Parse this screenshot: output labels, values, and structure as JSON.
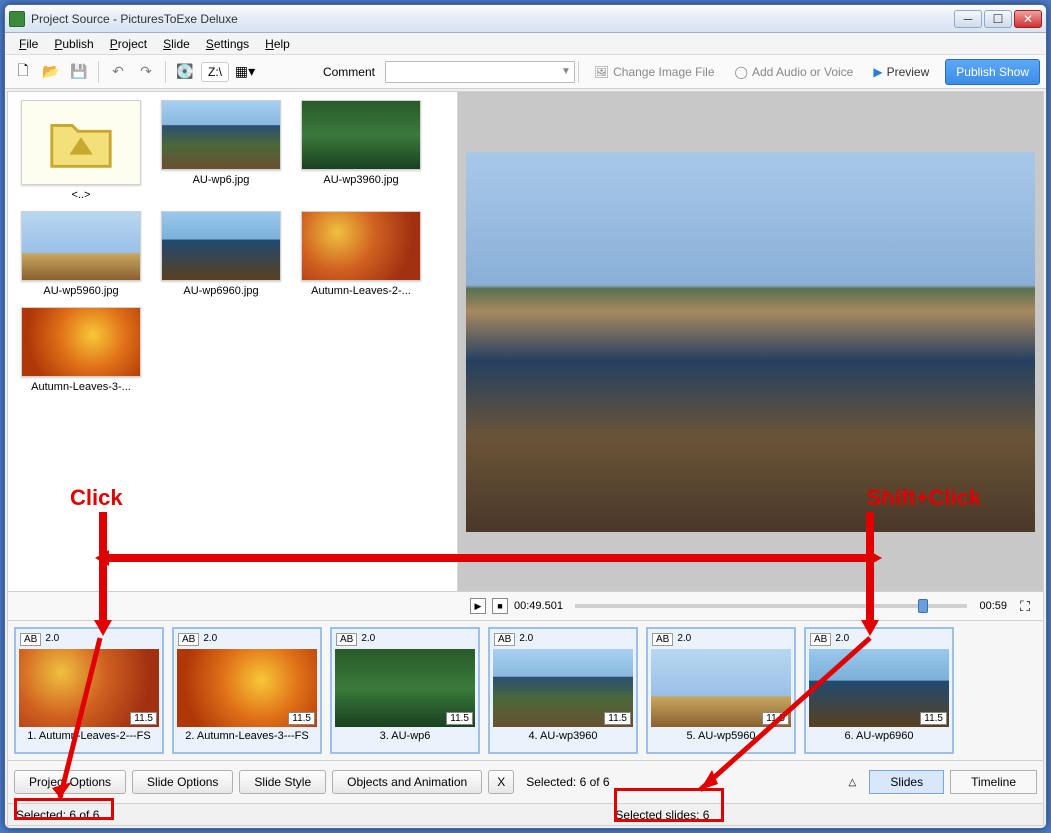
{
  "title": "Project Source - PicturesToExe Deluxe",
  "menu": [
    "File",
    "Publish",
    "Project",
    "Slide",
    "Settings",
    "Help"
  ],
  "toolbar": {
    "drive": "Z:\\",
    "comment_label": "Comment",
    "change_image": "Change Image File",
    "add_audio": "Add Audio or Voice",
    "preview": "Preview",
    "publish": "Publish Show"
  },
  "browser": {
    "items": [
      {
        "type": "folder",
        "caption": "<..>"
      },
      {
        "type": "img",
        "caption": "AU-wp6.jpg",
        "cls": "land-a"
      },
      {
        "type": "img",
        "caption": "AU-wp3960.jpg",
        "cls": "land-c"
      },
      {
        "type": "img",
        "caption": "AU-wp5960.jpg",
        "cls": "land-d"
      },
      {
        "type": "img",
        "caption": "AU-wp6960.jpg",
        "cls": "land-b"
      },
      {
        "type": "img",
        "caption": "Autumn-Leaves-2-...",
        "cls": "leaf-a"
      },
      {
        "type": "img",
        "caption": "Autumn-Leaves-3-...",
        "cls": "leaf-b"
      }
    ]
  },
  "playbar": {
    "time": "00:49.501",
    "end": "00:59"
  },
  "slides": [
    {
      "ab": "AB",
      "trans": "2.0",
      "dur": "11.5",
      "caption": "1. Autumn-Leaves-2---FS",
      "cls": "leaf-a"
    },
    {
      "ab": "AB",
      "trans": "2.0",
      "dur": "11.5",
      "caption": "2. Autumn-Leaves-3---FS",
      "cls": "leaf-b"
    },
    {
      "ab": "AB",
      "trans": "2.0",
      "dur": "11.5",
      "caption": "3. AU-wp6",
      "cls": "land-c"
    },
    {
      "ab": "AB",
      "trans": "2.0",
      "dur": "11.5",
      "caption": "4. AU-wp3960",
      "cls": "land-a"
    },
    {
      "ab": "AB",
      "trans": "2.0",
      "dur": "11.5",
      "caption": "5. AU-wp5960",
      "cls": "land-d"
    },
    {
      "ab": "AB",
      "trans": "2.0",
      "dur": "11.5",
      "caption": "6. AU-wp6960",
      "cls": "land-b"
    }
  ],
  "bottom": {
    "project_options": "Project Options",
    "slide_options": "Slide Options",
    "slide_style": "Slide Style",
    "objects_anim": "Objects and Animation",
    "x": "X",
    "selected": "Selected: 6 of 6",
    "slides_tab": "Slides",
    "timeline_tab": "Timeline"
  },
  "status": {
    "left": "Selected: 6 of 6",
    "mid": "Selected slides: 6"
  },
  "annotations": {
    "click": "Click",
    "shift_click": "Shift+Click"
  }
}
